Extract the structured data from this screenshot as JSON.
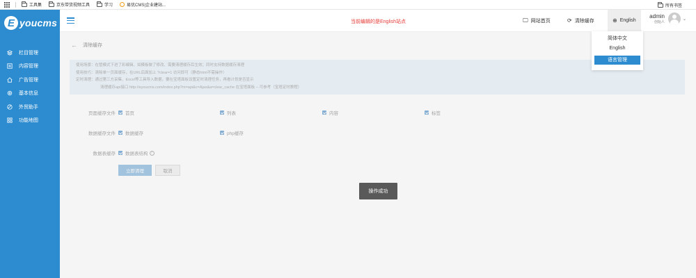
{
  "bookmarks": {
    "items": [
      "工具集",
      "京东带货视频工具",
      "学习",
      "易优CMS|企业建站..."
    ],
    "right": "所有书签"
  },
  "sidebar": {
    "logo_letter": "E",
    "logo_text": "youcms",
    "items": [
      {
        "label": "栏目管理",
        "icon": "layers-icon"
      },
      {
        "label": "内容管理",
        "icon": "document-icon"
      },
      {
        "label": "广告管理",
        "icon": "home-icon"
      },
      {
        "label": "基本信息",
        "icon": "gear-icon"
      },
      {
        "label": "外贸助手",
        "icon": "globe-icon"
      },
      {
        "label": "功能地图",
        "icon": "grid-icon"
      }
    ]
  },
  "header": {
    "notice": "当前编辑的是English站点",
    "home_label": "网站首页",
    "clear_label": "清除缓存",
    "lang_label": "English",
    "admin_name": "admin",
    "admin_role": "创始人"
  },
  "lang_dropdown": {
    "items": [
      "简体中文",
      "English"
    ],
    "manage_label": "语言管理"
  },
  "content": {
    "back_title": "清除缓存",
    "tips": [
      "使用场景：在管模式下进了彩编辑、如模板做了修改、需要清理缓存后生效；同时支持数据缓存清理",
      "使用技巧：清除单一页面缓存，在URL后面加上 ?clear=1 访问即可（静态html不需操作）",
      "定时清理：通过第三方采集、Excel等工具导入数据，要在宝塔面板设置定时清理任务，再看计划是否显示",
      "清理缓存api接口 http://eyoucms.com/index.php?m=api&c=Ajax&a=clear_cache 在宝塔面板 -- 可参考（宝塔定时教程）"
    ],
    "page_cache_label": "页面缓存文件",
    "page_cache_options": [
      "首页",
      "列表",
      "内容",
      "标签"
    ],
    "data_cache_label": "数据缓存文件",
    "data_cache_options": [
      "数据缓存",
      "php缓存"
    ],
    "db_cache_label": "数据表缓存",
    "db_cache_option": "数据表结构",
    "submit_label": "立即清理",
    "cancel_label": "取消"
  },
  "toast": "操作成功",
  "colors": {
    "sidebar": "#2d8cd0",
    "notice": "#e53935",
    "toast": "#595959"
  }
}
